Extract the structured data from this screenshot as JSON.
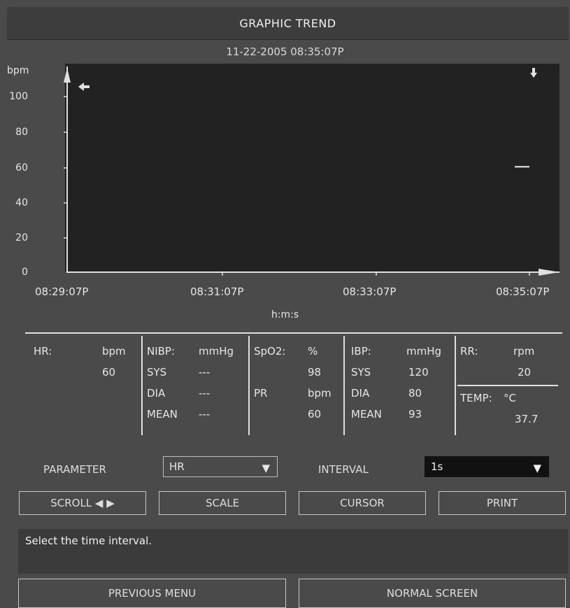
{
  "window": {
    "title": "GRAPHIC TREND"
  },
  "trend": {
    "timestamp": "11-22-2005  08:35:07P",
    "y_unit": "bpm",
    "y_ticks": [
      "100",
      "80",
      "60",
      "40",
      "20",
      "0"
    ],
    "x_ticks": [
      "08:29:07P",
      "08:31:07P",
      "08:33:07P",
      "08:35:07P"
    ],
    "x_unit": "h:m:s"
  },
  "chart_data": {
    "type": "line",
    "ylabel": "bpm",
    "xlabel": "h:m:s",
    "ylim": [
      0,
      110
    ],
    "x_categories": [
      "08:29:07P",
      "08:31:07P",
      "08:33:07P",
      "08:35:07P"
    ],
    "series": [
      {
        "values": [
          {
            "x": "08:35:07P",
            "y": 60
          }
        ]
      }
    ],
    "grid": false
  },
  "params": {
    "hr": {
      "label": "HR:",
      "unit": "bpm",
      "value": "60"
    },
    "nibp": {
      "label": "NIBP:",
      "unit": "mmHg",
      "sys_label": "SYS",
      "sys": "---",
      "dia_label": "DIA",
      "dia": "---",
      "mean_label": "MEAN",
      "mean": "---"
    },
    "spo2": {
      "label": "SpO2:",
      "unit": "%",
      "value": "98",
      "pr_label": "PR",
      "pr_unit": "bpm",
      "pr_value": "60"
    },
    "ibp": {
      "label": "IBP:",
      "unit": "mmHg",
      "sys_label": "SYS",
      "sys": "120",
      "dia_label": "DIA",
      "dia": "80",
      "mean_label": "MEAN",
      "mean": "93"
    },
    "rr": {
      "label": "RR:",
      "unit": "rpm",
      "value": "20"
    },
    "temp": {
      "label": "TEMP:",
      "unit": "°C",
      "value": "37.7"
    }
  },
  "controls": {
    "parameter_label": "PARAMETER",
    "parameter_value": "HR",
    "interval_label": "INTERVAL",
    "interval_value": "1s",
    "caret": "▼"
  },
  "buttons": {
    "scroll": "SCROLL ◀ ▶",
    "scale": "SCALE",
    "cursor": "CURSOR",
    "print": "PRINT",
    "previous_menu": "PREVIOUS MENU",
    "normal_screen": "NORMAL SCREEN"
  },
  "message": "Select the time interval."
}
